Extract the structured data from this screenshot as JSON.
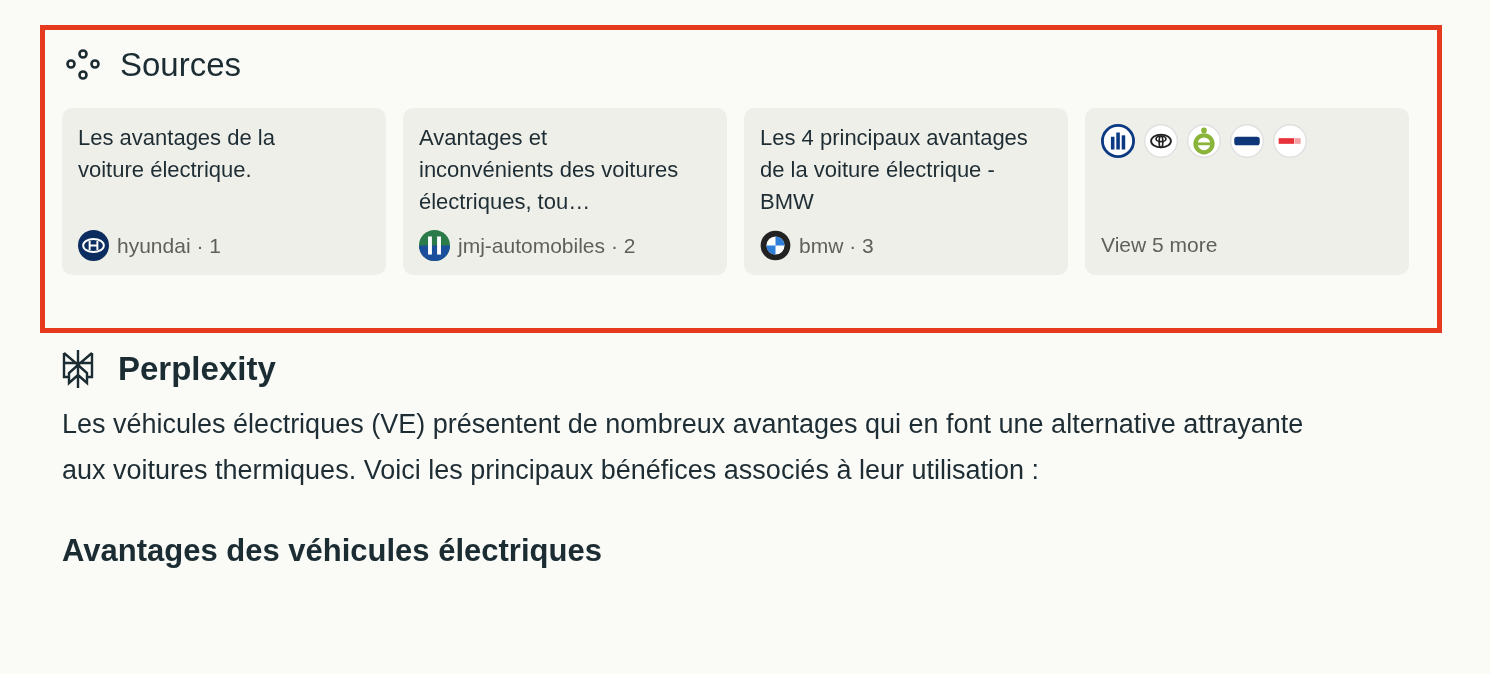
{
  "sources": {
    "title": "Sources",
    "cards": [
      {
        "kind": "article",
        "title": "Les avantages de la voiture électrique.",
        "site": "hyundai · 1"
      },
      {
        "kind": "article",
        "title": "Avantages et inconvénients des voitures électriques, tou…",
        "site": "jmj-automobiles · 2"
      },
      {
        "kind": "article",
        "title": "Les 4 principaux avantages de la voiture électrique - BMW",
        "site": "bmw · 3"
      },
      {
        "kind": "more",
        "label": "View 5 more"
      }
    ]
  },
  "answer": {
    "title": "Perplexity",
    "paragraph": "Les véhicules électriques (VE) présentent de nombreux avantages qui en font une alternative attrayante aux voitures thermiques. Voici les principaux bénéfices associés à leur utilisation :",
    "heading": "Avantages des véhicules électriques"
  }
}
